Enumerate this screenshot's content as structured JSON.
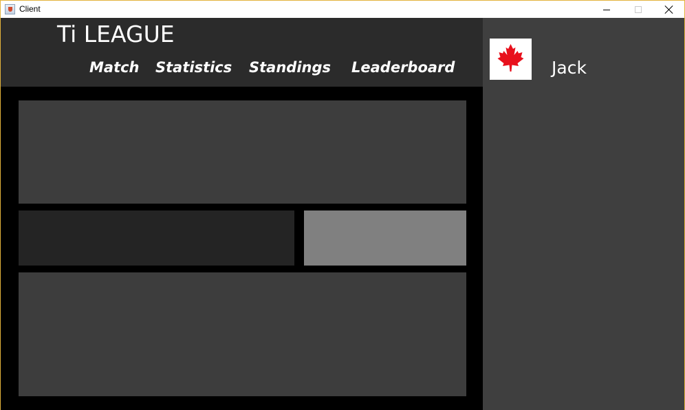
{
  "window": {
    "title": "Client",
    "icon": "java-cup-icon"
  },
  "header": {
    "brand": "Ti LEAGUE",
    "nav": [
      {
        "label": "Match"
      },
      {
        "label": "Statistics"
      },
      {
        "label": "Standings"
      },
      {
        "label": "Leaderboard"
      }
    ]
  },
  "user": {
    "name": "Jack",
    "flag_icon": "canada-flag-icon"
  },
  "colors": {
    "header_bg": "#2b2b2b",
    "sidebar_bg": "#3f3f3f",
    "panel_dark": "#242424",
    "panel_mid": "#3d3d3d",
    "panel_light": "#808080",
    "flag_red": "#e8101c"
  }
}
